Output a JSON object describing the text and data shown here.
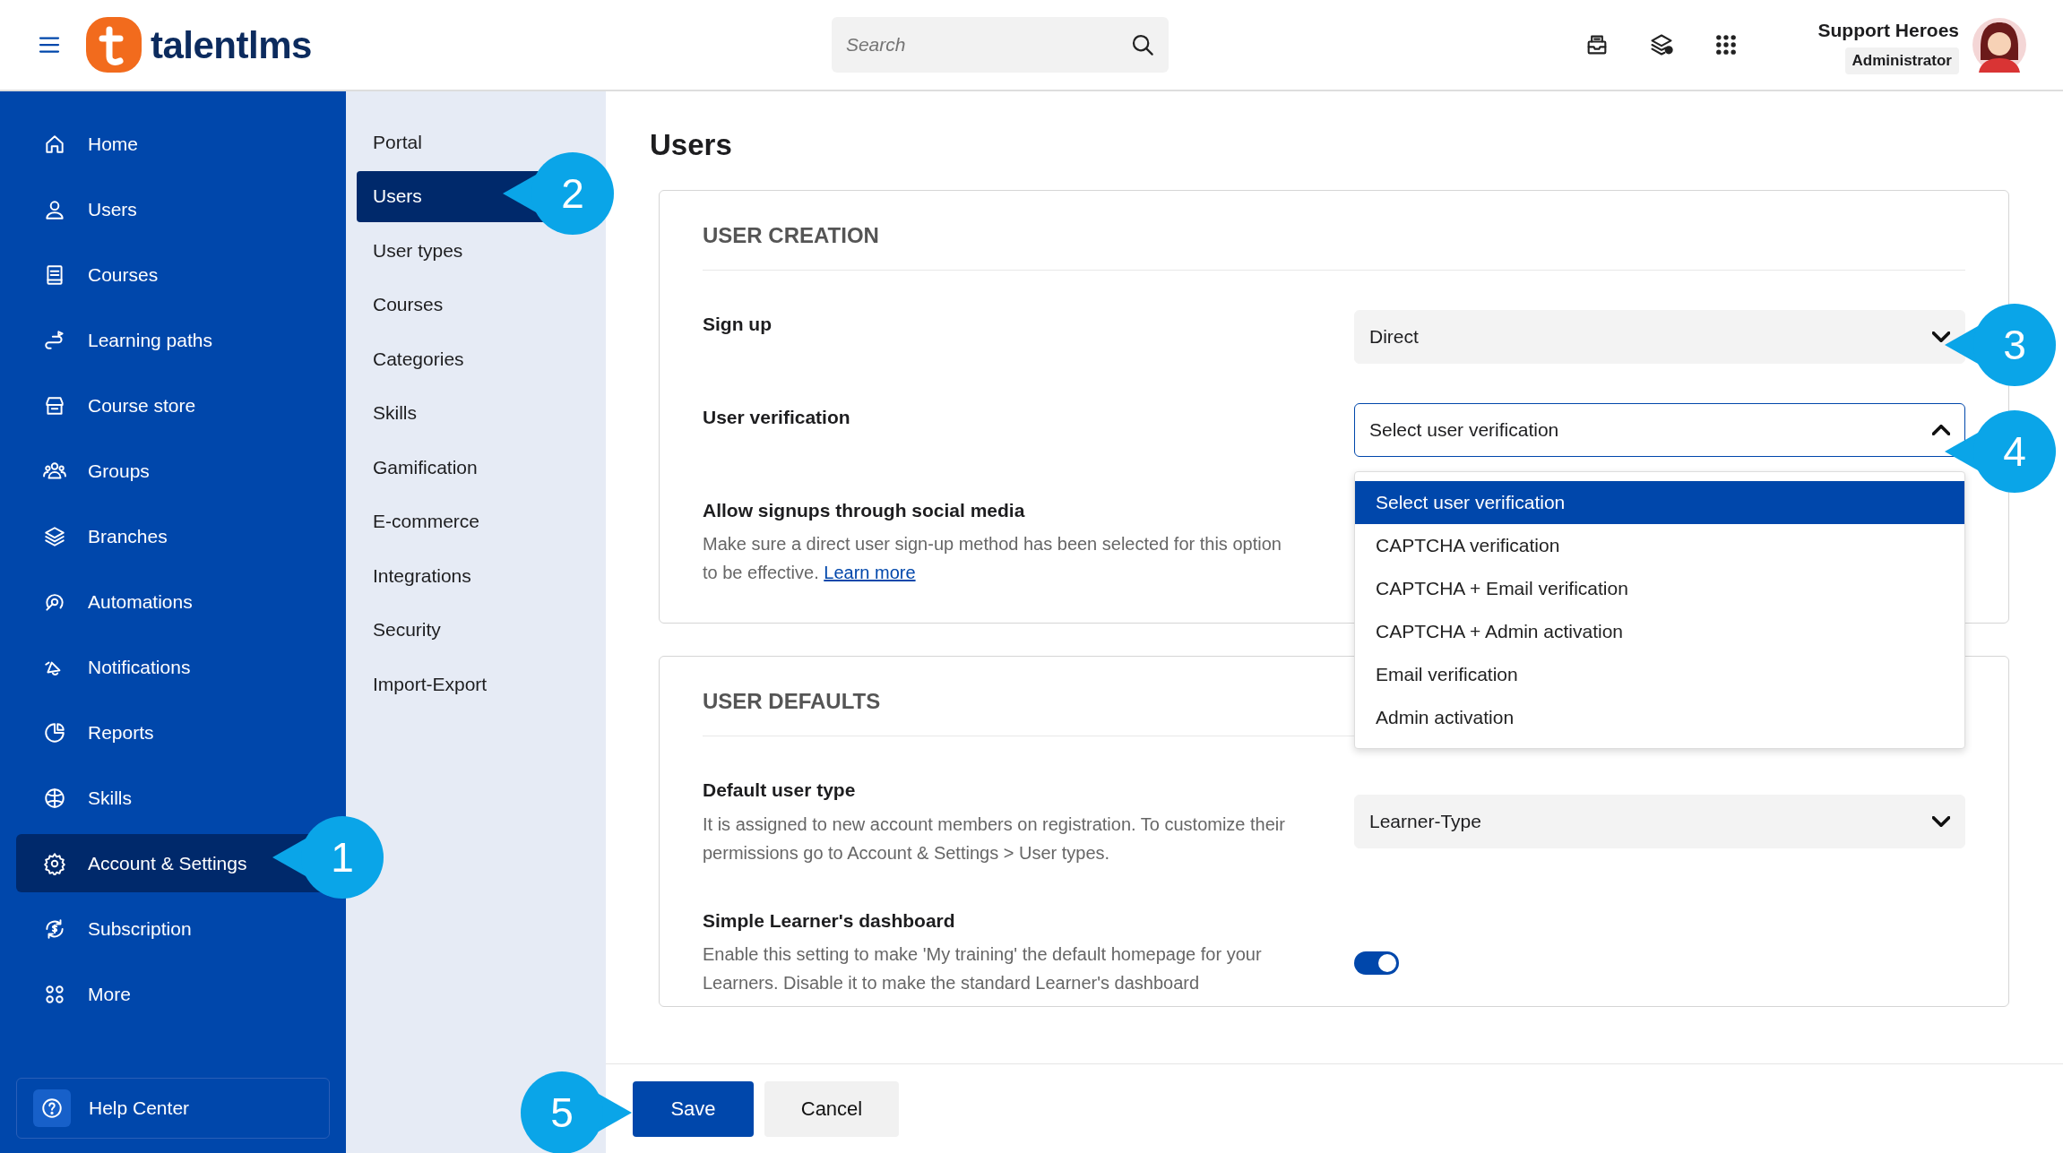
{
  "header": {
    "logo": "talentlms",
    "search": {
      "placeholder": "Search"
    },
    "user": {
      "name": "Support Heroes",
      "role": "Administrator"
    }
  },
  "sidebar": {
    "items": [
      {
        "label": "Home",
        "selected": false
      },
      {
        "label": "Users",
        "selected": false
      },
      {
        "label": "Courses",
        "selected": false
      },
      {
        "label": "Learning paths",
        "selected": false
      },
      {
        "label": "Course store",
        "selected": false
      },
      {
        "label": "Groups",
        "selected": false
      },
      {
        "label": "Branches",
        "selected": false
      },
      {
        "label": "Automations",
        "selected": false
      },
      {
        "label": "Notifications",
        "selected": false
      },
      {
        "label": "Reports",
        "selected": false
      },
      {
        "label": "Skills",
        "selected": false
      },
      {
        "label": "Account & Settings",
        "selected": true
      },
      {
        "label": "Subscription",
        "selected": false
      },
      {
        "label": "More",
        "selected": false
      }
    ],
    "help": "Help Center"
  },
  "subnav": {
    "items": [
      {
        "label": "Portal",
        "selected": false
      },
      {
        "label": "Users",
        "selected": true
      },
      {
        "label": "User types",
        "selected": false
      },
      {
        "label": "Courses",
        "selected": false
      },
      {
        "label": "Categories",
        "selected": false
      },
      {
        "label": "Skills",
        "selected": false
      },
      {
        "label": "Gamification",
        "selected": false
      },
      {
        "label": "E-commerce",
        "selected": false
      },
      {
        "label": "Integrations",
        "selected": false
      },
      {
        "label": "Security",
        "selected": false
      },
      {
        "label": "Import-Export",
        "selected": false
      }
    ]
  },
  "page": {
    "title": "Users",
    "sections": [
      {
        "title": "USER CREATION",
        "settings": [
          {
            "kind": "select",
            "label": "Sign up",
            "value": "Direct",
            "expanded": false
          },
          {
            "kind": "select",
            "label": "User verification",
            "value": "Select user verification",
            "expanded": true,
            "options": [
              {
                "label": "Select user verification",
                "selected": true
              },
              {
                "label": "CAPTCHA verification",
                "selected": false
              },
              {
                "label": "CAPTCHA + Email verification",
                "selected": false
              },
              {
                "label": "CAPTCHA + Admin activation",
                "selected": false
              },
              {
                "label": "Email verification",
                "selected": false
              },
              {
                "label": "Admin activation",
                "selected": false
              }
            ]
          },
          {
            "kind": "info",
            "label": "Allow signups through social media",
            "description": "Make sure a direct user sign-up method has been selected for this option to be effective.",
            "link": "Learn more"
          }
        ]
      },
      {
        "title": "USER DEFAULTS",
        "settings": [
          {
            "kind": "select",
            "label": "Default user type",
            "description": "It is assigned to new account members on registration. To customize their permissions go to Account & Settings > User types.",
            "value": "Learner-Type",
            "expanded": false
          },
          {
            "kind": "toggle",
            "label": "Simple Learner's dashboard",
            "description": "Enable this setting to make 'My training' the default homepage for your Learners. Disable it to make the standard Learner's dashboard",
            "on": true
          }
        ]
      }
    ]
  },
  "footer": {
    "buttons": [
      {
        "label": "Save",
        "kind": "primary"
      },
      {
        "label": "Cancel",
        "kind": "secondary"
      }
    ]
  },
  "callouts": [
    {
      "label": "1"
    },
    {
      "label": "2"
    },
    {
      "label": "3"
    },
    {
      "label": "4"
    },
    {
      "label": "5"
    }
  ]
}
